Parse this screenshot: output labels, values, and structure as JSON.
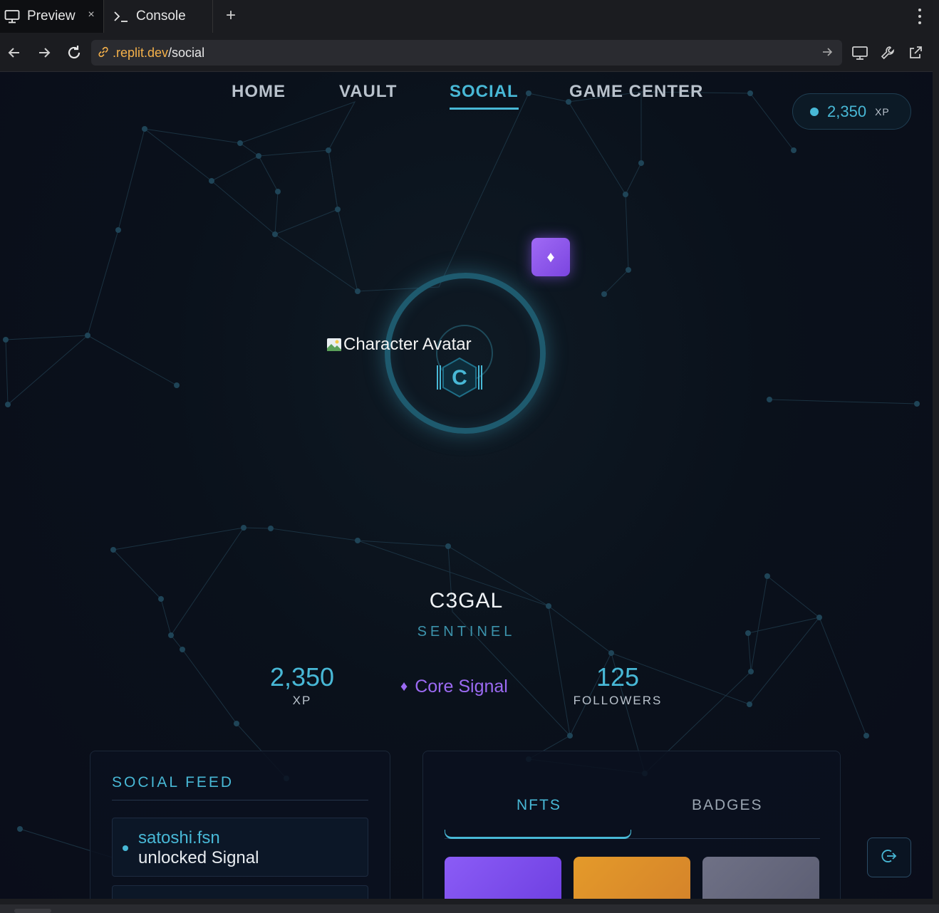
{
  "browser": {
    "tabs": [
      {
        "label": "Preview",
        "icon": "monitor-icon",
        "active": true
      },
      {
        "label": "Console",
        "icon": "terminal-icon",
        "active": false
      }
    ],
    "new_tab_symbol": "+",
    "close_symbol": "×",
    "url_domain": ".replit.dev",
    "url_path": "/social"
  },
  "nav": {
    "items": [
      {
        "label": "HOME",
        "active": false
      },
      {
        "label": "VAULT",
        "active": false
      },
      {
        "label": "SOCIAL",
        "active": true
      },
      {
        "label": "GAME CENTER",
        "active": false
      }
    ]
  },
  "xp_badge": {
    "value": "2,350",
    "unit": "XP"
  },
  "avatar": {
    "alt_text": "Character Avatar",
    "badge_icon": "diamond-icon",
    "logo_letter": "C"
  },
  "profile": {
    "name": "C3GAL",
    "role": "SENTINEL",
    "xp_value": "2,350",
    "xp_label": "XP",
    "signal_icon": "♦",
    "signal_label": "Core Signal",
    "followers_value": "125",
    "followers_label": "FOLLOWERS"
  },
  "social_feed": {
    "title": "SOCIAL FEED",
    "items": [
      {
        "user": "satoshi.fsn",
        "action": "unlocked Signal"
      }
    ]
  },
  "assets": {
    "tabs": [
      {
        "label": "NFTS",
        "active": true
      },
      {
        "label": "BADGES",
        "active": false
      }
    ],
    "cards": [
      {
        "color_from": "#8b5cf6",
        "color_to": "#6d3ee0"
      },
      {
        "color_from": "#e49a2a",
        "color_to": "#d4822a"
      },
      {
        "color_from": "#6f7186",
        "color_to": "#5b5d72"
      }
    ]
  },
  "colors": {
    "accent": "#48b8d6",
    "purple": "#9b6af2",
    "background": "#0a0f1a"
  }
}
